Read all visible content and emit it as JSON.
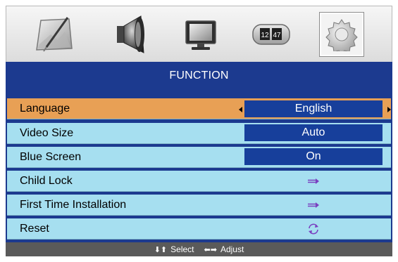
{
  "tabs": [
    {
      "icon": "picture-icon",
      "selected": false
    },
    {
      "icon": "speaker-icon",
      "selected": false
    },
    {
      "icon": "monitor-icon",
      "selected": false
    },
    {
      "icon": "clock-icon",
      "selected": false,
      "clock_hours": "12",
      "clock_minutes": "47"
    },
    {
      "icon": "gear-icon",
      "selected": true
    }
  ],
  "menu": {
    "title": "FUNCTION",
    "items": [
      {
        "label": "Language",
        "value": "English",
        "selected": true
      },
      {
        "label": "Video Size",
        "value": "Auto"
      },
      {
        "label": "Blue Screen",
        "value": "On"
      },
      {
        "label": "Child Lock",
        "icon": "enter-arrow-icon"
      },
      {
        "label": "First Time Installation",
        "icon": "enter-arrow-icon"
      },
      {
        "label": "Reset",
        "icon": "reset-icon"
      }
    ]
  },
  "footer": {
    "select_keys": "⬇⬆",
    "select_label": "Select",
    "adjust_keys": "⬅➡",
    "adjust_label": "Adjust"
  },
  "colors": {
    "panel": "#1c3a8f",
    "row": "#a6dff0",
    "row_selected": "#e8a055",
    "value_box": "#173f9b",
    "footer": "#5a5a5a"
  }
}
